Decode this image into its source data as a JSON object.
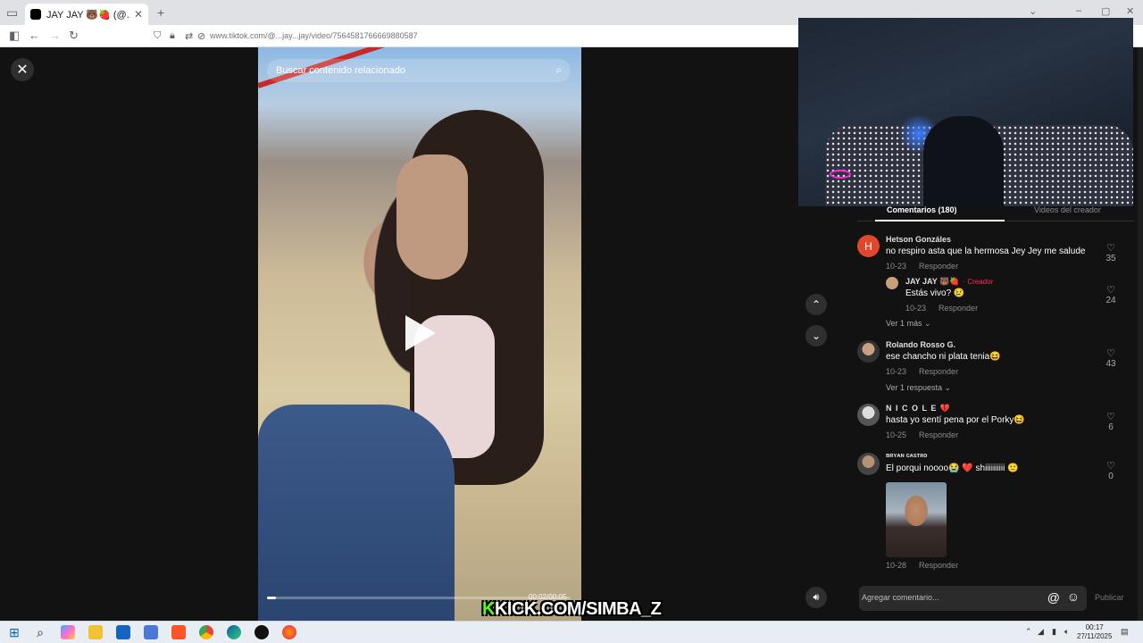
{
  "browser": {
    "tab_title": "JAY JAY 🐻🍓 (@...jay...jay) | Ti",
    "tab_close": "✕",
    "new_tab": "+",
    "url": "www.tiktok.com/@...jay...jay/video/7564581766669880587"
  },
  "player": {
    "close_label": "✕",
    "search_placeholder": "Buscar contenido relacionado",
    "time": "00:02/00:05",
    "progress_fraction": 0.03
  },
  "panel": {
    "tab_comments": "Comentarios (180)",
    "tab_creator": "Videos del creador",
    "comments": [
      {
        "author": "Hetson Gonzáles",
        "text": "no respiro asta que la hermosa Jey Jey me salude",
        "date": "10-23",
        "reply": "Responder",
        "likes": "35",
        "avatar_letter": "H"
      },
      {
        "author": "JAY JAY 🐻🍓",
        "creator_tag": "· Creador",
        "text": "Estás vivo? 😢",
        "date": "10-23",
        "reply": "Responder",
        "likes": "24"
      },
      {
        "author": "Rolando Rosso G.",
        "text": "ese chancho ni plata tenia😆",
        "date": "10-23",
        "reply": "Responder",
        "likes": "43"
      },
      {
        "author": "N I C O L E 💔",
        "text": "hasta yo sentí pena por el Porky😆",
        "date": "10-25",
        "reply": "Responder",
        "likes": "6"
      },
      {
        "author": "ʙʀʏᴀɴ ᴄᴀsᴛʀᴏ",
        "text": "El porqui noooo😭 ❤️ shiiiiiiiiii 🙂",
        "date": "10-28",
        "reply": "Responder",
        "likes": "0"
      }
    ],
    "more_1": "Ver 1 más ⌄",
    "more_2": "Ver 1 respuesta ⌄",
    "input_placeholder": "Agregar comentario...",
    "at_symbol": "@",
    "emoji_symbol": "☺",
    "publish": "Publicar"
  },
  "overlay": {
    "kick_k": "K",
    "kick_text": "KICK.COM/SIMBA_Z"
  },
  "taskbar": {
    "time": "00:17",
    "date": "27/11/2025"
  }
}
